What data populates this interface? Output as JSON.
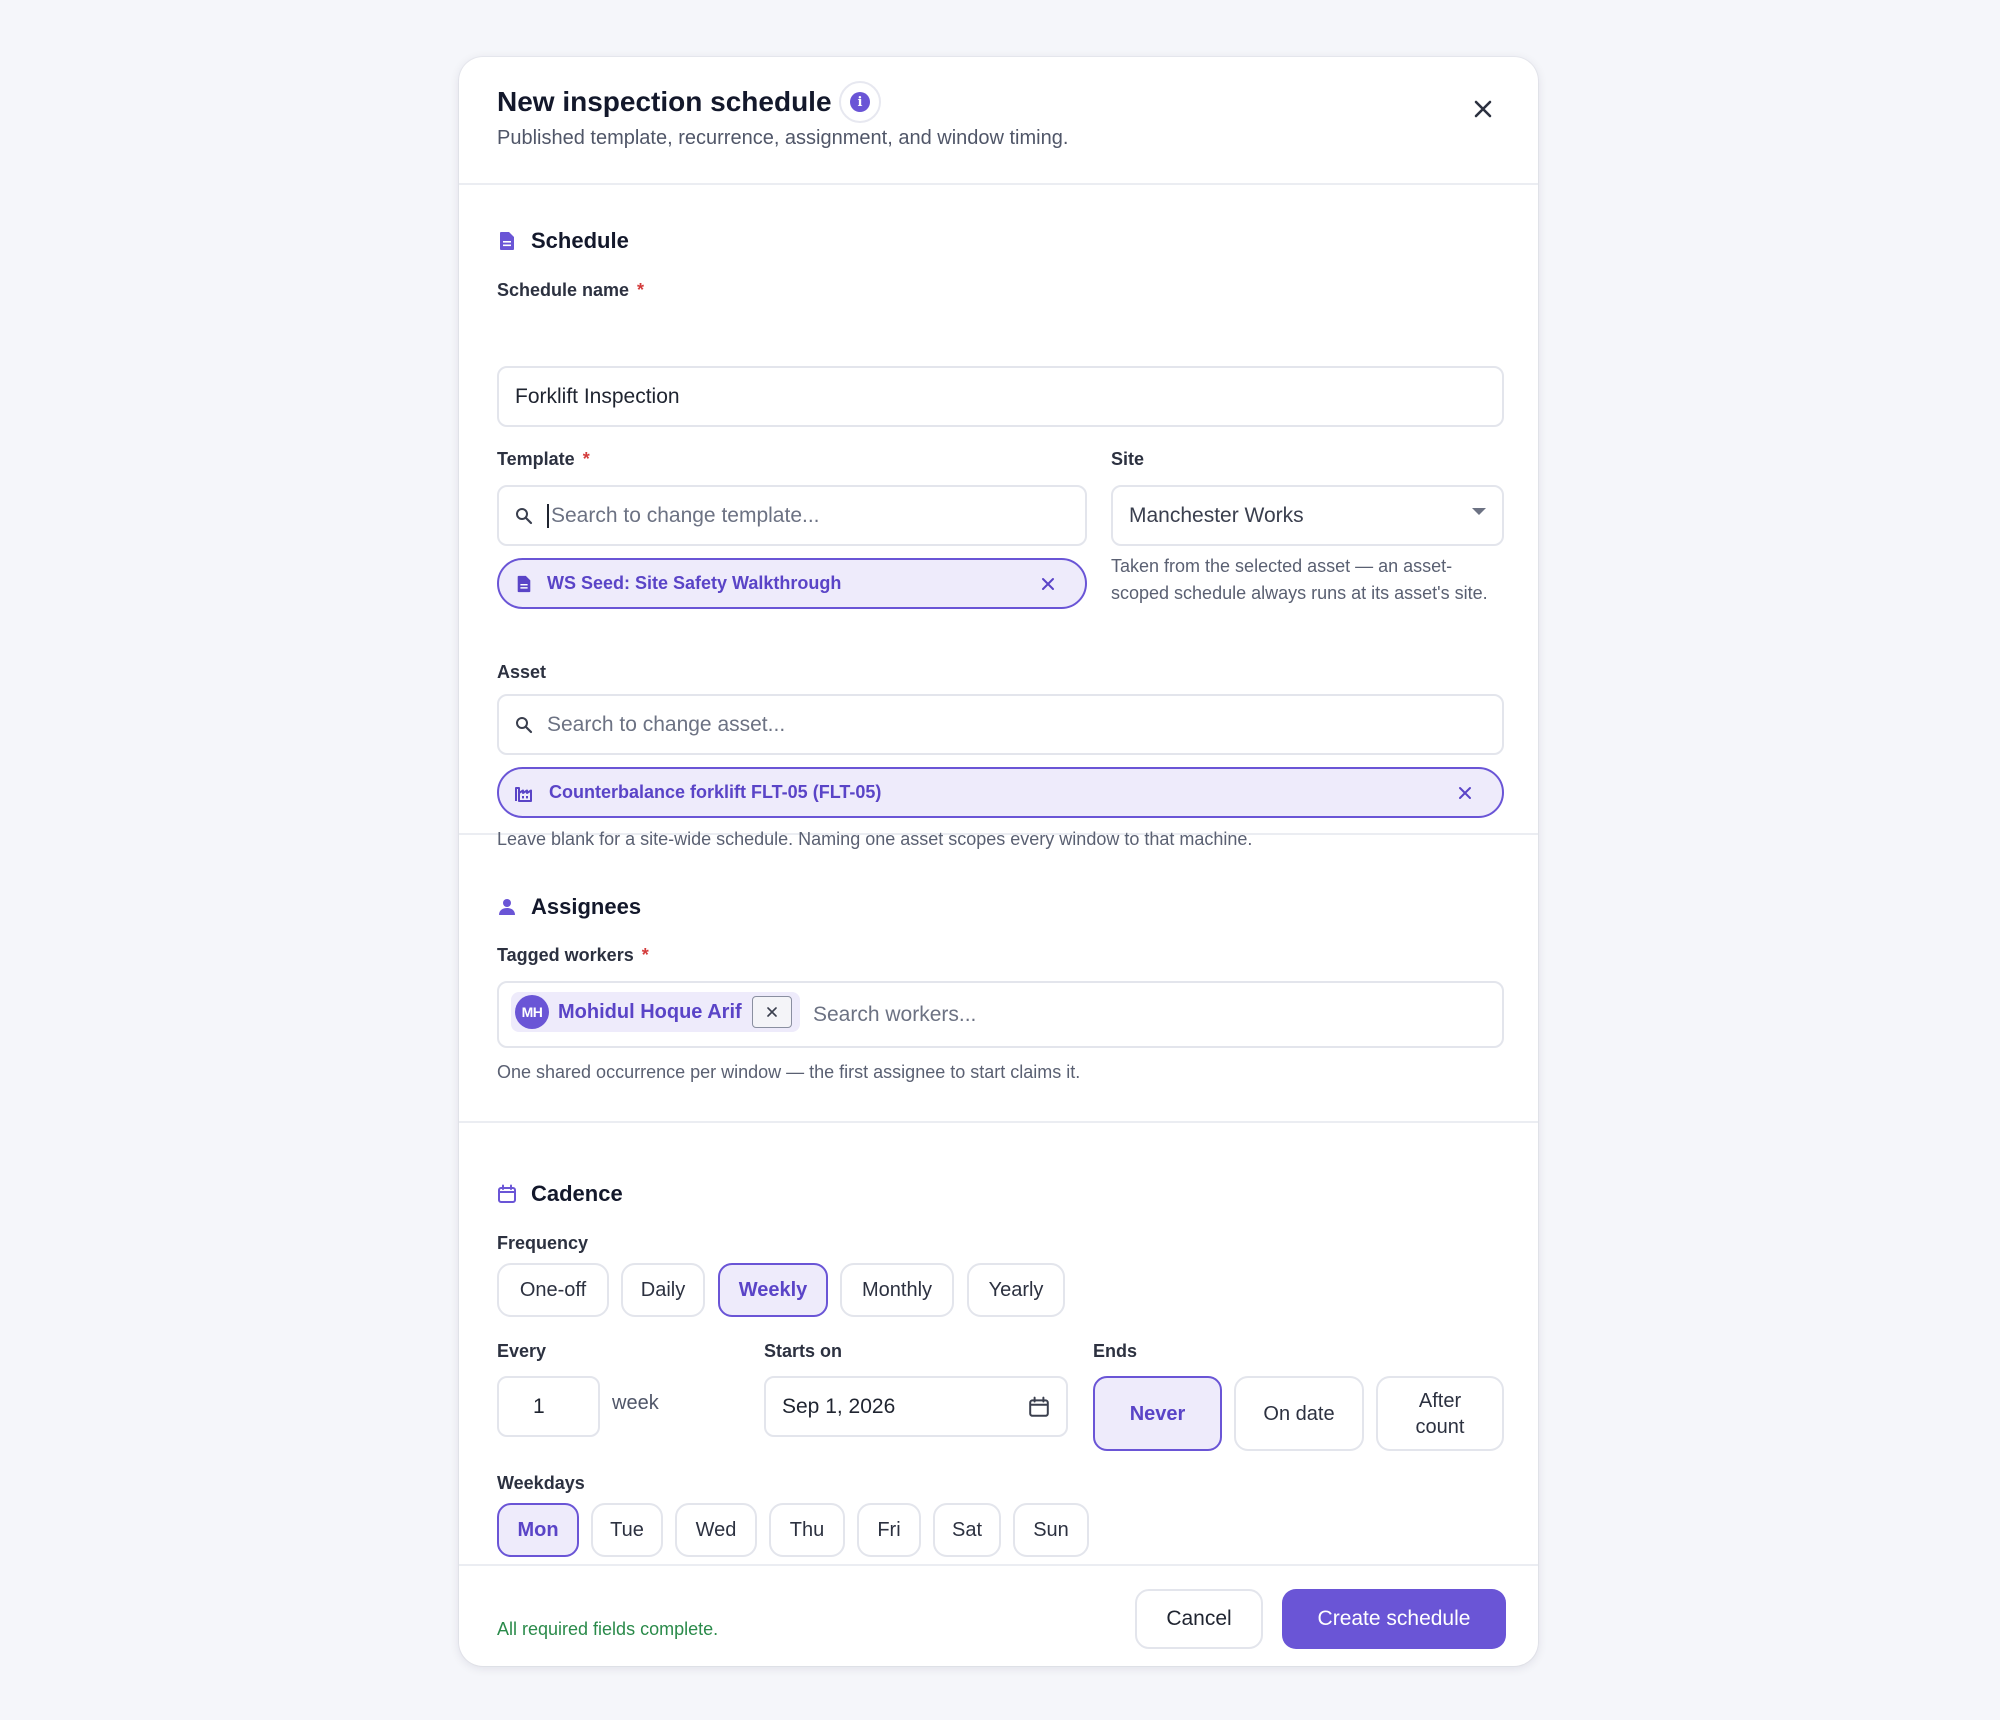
{
  "dialog": {
    "title": "New inspection schedule",
    "subtitle": "Published template, recurrence, assignment, and window timing."
  },
  "schedule": {
    "section_title": "Schedule",
    "name_label": "Schedule name",
    "required_mark": "*",
    "name_value": "Forklift Inspection",
    "template_label": "Template",
    "template_placeholder": "Search to change template...",
    "template_selected": "WS Seed: Site Safety Walkthrough",
    "site_label": "Site",
    "site_value": "Manchester Works",
    "site_help": "Taken from the selected asset — an asset-scoped schedule always runs at its asset's site.",
    "asset_label": "Asset",
    "asset_placeholder": "Search to change asset...",
    "asset_selected": "Counterbalance forklift FLT-05 (FLT-05)",
    "asset_help": "Leave blank for a site-wide schedule. Naming one asset scopes every window to that machine."
  },
  "assignees": {
    "section_title": "Assignees",
    "workers_label": "Tagged workers",
    "worker_initials": "MH",
    "worker_name": "Mohidul Hoque Arif",
    "search_placeholder": "Search workers...",
    "help": "One shared occurrence per window — the first assignee to start claims it."
  },
  "cadence": {
    "section_title": "Cadence",
    "frequency_label": "Frequency",
    "frequency_options": [
      "One-off",
      "Daily",
      "Weekly",
      "Monthly",
      "Yearly"
    ],
    "frequency_selected": "Weekly",
    "every_label": "Every",
    "every_value": "1",
    "every_unit": "week",
    "starts_label": "Starts on",
    "starts_value": "Sep 1, 2026",
    "ends_label": "Ends",
    "ends_options": [
      "Never",
      "On date",
      "After count"
    ],
    "ends_selected": "Never",
    "weekdays_label": "Weekdays",
    "weekdays": [
      "Mon",
      "Tue",
      "Wed",
      "Thu",
      "Fri",
      "Sat",
      "Sun"
    ],
    "weekdays_selected": [
      "Mon"
    ]
  },
  "footer": {
    "status": "All required fields complete.",
    "cancel_label": "Cancel",
    "create_label": "Create schedule"
  },
  "colors": {
    "accent": "#6a55d6",
    "accent_soft": "#eeebfb",
    "success": "#2a8a4a",
    "required": "#d33b3b"
  }
}
